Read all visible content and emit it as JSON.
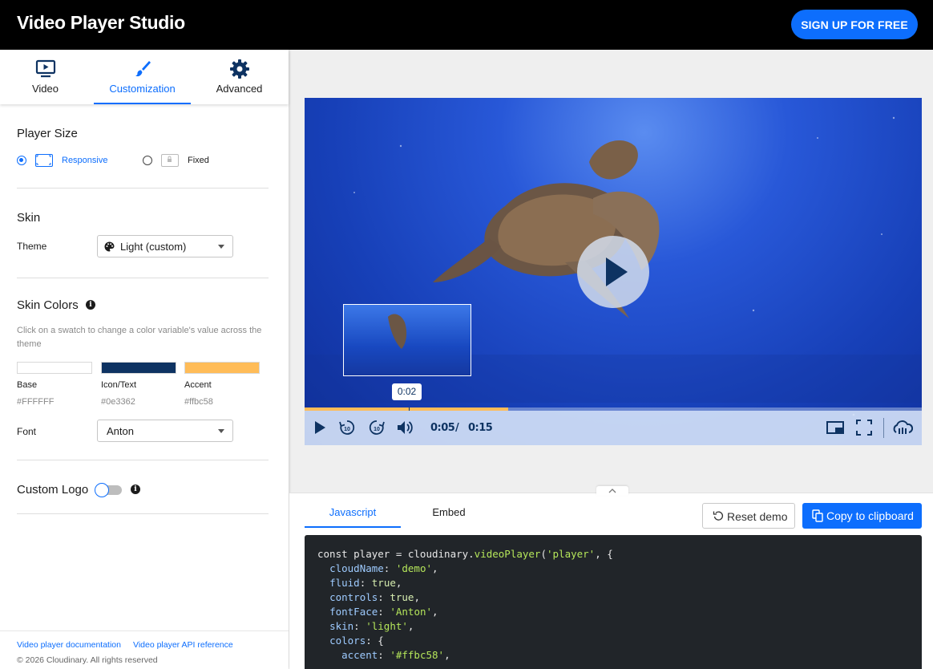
{
  "header": {
    "title": "Video Player Studio",
    "signup_label": "SIGN UP FOR FREE"
  },
  "sidebar": {
    "tabs": [
      {
        "label": "Video",
        "icon": "video-screen-icon",
        "active": false
      },
      {
        "label": "Customization",
        "icon": "brush-icon",
        "active": true
      },
      {
        "label": "Advanced",
        "icon": "gear-icon",
        "active": false
      }
    ],
    "player_size": {
      "title": "Player Size",
      "options": [
        {
          "label": "Responsive",
          "selected": true
        },
        {
          "label": "Fixed",
          "selected": false
        }
      ]
    },
    "skin": {
      "title": "Skin",
      "theme_label": "Theme",
      "theme_value": "Light (custom)"
    },
    "skin_colors": {
      "title": "Skin Colors",
      "hint": "Click on a swatch to change a color variable's value across the theme",
      "swatches": [
        {
          "name": "Base",
          "hex": "#FFFFFF",
          "color": "#ffffff"
        },
        {
          "name": "Icon/Text",
          "hex": "#0e3362",
          "color": "#0e3362"
        },
        {
          "name": "Accent",
          "hex": "#ffbc58",
          "color": "#ffbc58"
        }
      ],
      "font_label": "Font",
      "font_value": "Anton"
    },
    "custom_logo": {
      "title": "Custom Logo",
      "enabled": false
    },
    "footer": {
      "links": [
        "Video player documentation",
        "Video player API reference"
      ],
      "copyright": "© 2026 Cloudinary. All rights reserved"
    }
  },
  "player": {
    "preview_time": "0:02",
    "current_time": "0:05",
    "separator": "/",
    "duration": "0:15",
    "progress_fraction": 0.33,
    "hover_fraction": 0.167,
    "colors": {
      "accent": "#ffbc58",
      "icon_text": "#0e3362"
    }
  },
  "code_panel": {
    "tabs": [
      {
        "label": "Javascript",
        "active": true
      },
      {
        "label": "Embed",
        "active": false
      }
    ],
    "reset_label": "Reset demo",
    "copy_label": "Copy to clipboard",
    "code_lines": [
      "const player = cloudinary.videoPlayer('player', {",
      "  cloudName: 'demo',",
      "  fluid: true,",
      "  controls: true,",
      "  fontFace: 'Anton',",
      "  skin: 'light',",
      "  colors: {",
      "    accent: '#ffbc58',"
    ]
  }
}
